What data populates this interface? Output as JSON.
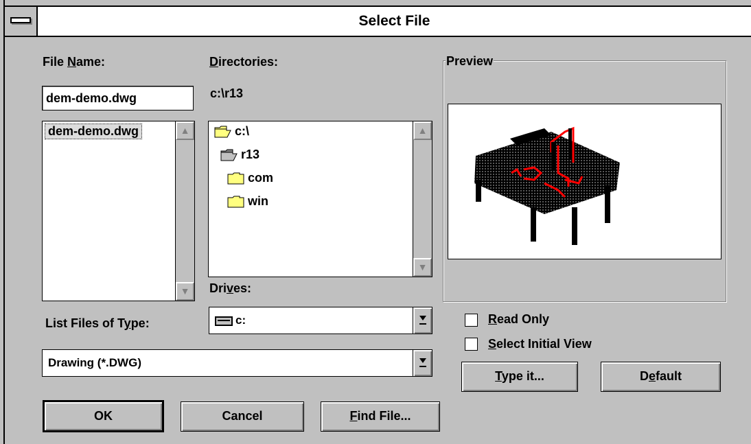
{
  "window": {
    "title": "Select File"
  },
  "file_name": {
    "label_pre": "File ",
    "label_key": "N",
    "label_post": "ame:",
    "value": "dem-demo.dwg",
    "files": [
      "dem-demo.dwg"
    ]
  },
  "directories": {
    "label_key": "D",
    "label_post": "irectories:",
    "current_path": "c:\\r13",
    "items": [
      {
        "name": "c:\\",
        "icon": "open-folder-icon"
      },
      {
        "name": "r13",
        "icon": "open-folder-icon"
      },
      {
        "name": "com",
        "icon": "folder-icon"
      },
      {
        "name": "win",
        "icon": "folder-icon"
      }
    ]
  },
  "drives": {
    "label_pre": "Dri",
    "label_key": "v",
    "label_post": "es:",
    "value": "c:"
  },
  "file_type": {
    "label_pre": "List Files of T",
    "label_key": "y",
    "label_post": "pe:",
    "value": "Drawing (*.DWG)"
  },
  "preview": {
    "label": "Preview"
  },
  "options": {
    "read_only": {
      "key": "R",
      "rest": "ead Only",
      "checked": false
    },
    "select_initial_view": {
      "key": "S",
      "rest": "elect Initial View",
      "checked": false
    }
  },
  "buttons": {
    "type_it": {
      "key": "T",
      "rest": "ype it..."
    },
    "default": {
      "pre": "D",
      "key": "e",
      "rest": "fault"
    },
    "ok": "OK",
    "cancel": "Cancel",
    "find_file": {
      "key": "F",
      "rest": "ind File..."
    }
  },
  "colors": {
    "face": "#c0c0c0",
    "shadow": "#808080",
    "highlight": "#ffffff",
    "drawing_accent": "#ff0000",
    "folder": "#ffff80"
  }
}
